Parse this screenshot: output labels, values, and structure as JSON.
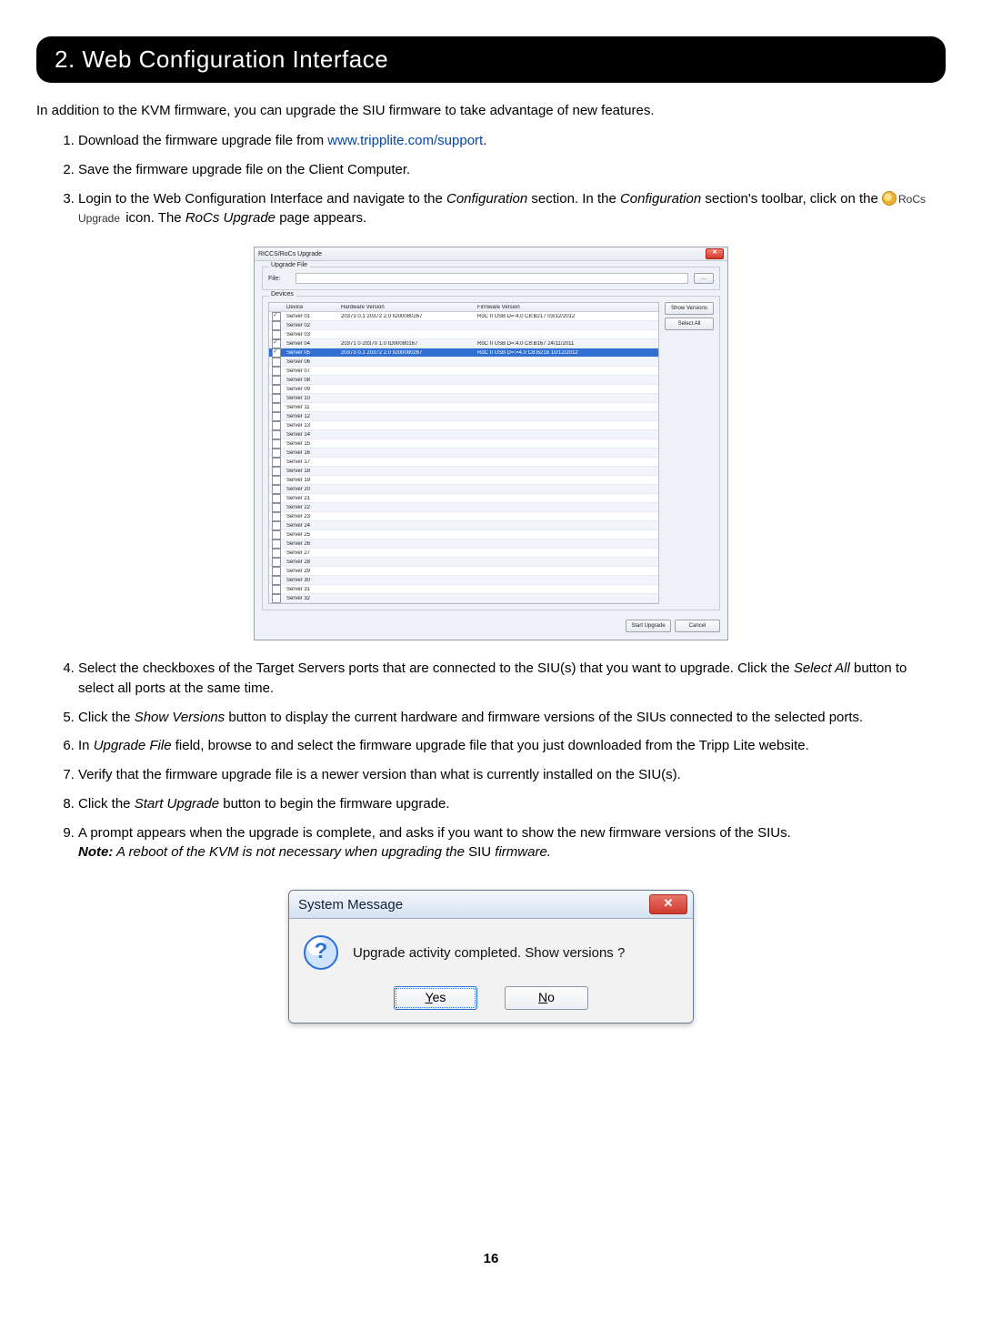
{
  "section_title": "2. Web Configuration Interface",
  "intro": "In addition to the KVM firmware, you can upgrade the SIU firmware to take advantage of new features.",
  "link_text": "www.tripplite.com/support",
  "rocs_label": "RoCs Upgrade",
  "steps": {
    "s1a": "Download the firmware upgrade file from ",
    "s1b": ".",
    "s2": "Save the firmware upgrade file on the Client Computer.",
    "s3a": "Login to the Web Configuration Interface and navigate to the ",
    "s3b": " section. In the ",
    "s3c": " section's toolbar, click on the ",
    "s3d": " icon. The ",
    "s3e": " page appears.",
    "s3_config": "Configuration",
    "s3_rocs": "RoCs Upgrade",
    "s4a": "Select the checkboxes of the Target Servers ports that are connected to the SIU(s) that you want to upgrade. Click the ",
    "s4b": " button to select all ports at the same time.",
    "s4_selectall": "Select All",
    "s5a": "Click the ",
    "s5b": " button to display the current hardware and firmware versions of the SIUs connected to the selected ports.",
    "s5_showver": "Show Versions",
    "s6a": "In ",
    "s6b": " field, browse to and select the firmware upgrade file that you just downloaded from the Tripp Lite website.",
    "s6_upfile": "Upgrade File",
    "s7": "Verify that the firmware upgrade file is a newer version than what is currently installed on the SIU(s).",
    "s8a": "Click the ",
    "s8b": " button to begin the firmware upgrade.",
    "s8_start": "Start Upgrade",
    "s9a": "A prompt appears when the upgrade is complete, and asks if you want to show the new firmware versions of the SIUs.",
    "s9_note_lbl": "Note:",
    "s9_note_a": " A reboot of the KVM is not necessary when upgrading the ",
    "s9_note_b": "SIU",
    "s9_note_c": " firmware."
  },
  "riccs": {
    "title": "RICCS/RoCs Upgrade",
    "upgrade_file_legend": "Upgrade File",
    "file_lbl": "File:",
    "browse": "…",
    "devices_legend": "Devices",
    "cols": {
      "device": "Device",
      "hw": "Hardware Version",
      "fw": "Firmware Version"
    },
    "side": {
      "show": "Show Versions",
      "select": "Select All"
    },
    "footer": {
      "start": "Start Upgrade",
      "cancel": "Cancel"
    },
    "rows": [
      {
        "n": "Server 01",
        "chk": true,
        "hw": "20373 0.1 20372 2.0 ID00080267",
        "fw": "RoC II USB D=:4.0 C8:B217 03/12/2012",
        "sel": false
      },
      {
        "n": "Server 02",
        "chk": false,
        "hw": "",
        "fw": "",
        "sel": false
      },
      {
        "n": "Server 03",
        "chk": false,
        "hw": "",
        "fw": "",
        "sel": false
      },
      {
        "n": "Server 04",
        "chk": true,
        "hw": "20371 0 20370 1.0 ID00080167",
        "fw": "RoC II USB D=:4.0 C8:B167 24/11/2011",
        "sel": false
      },
      {
        "n": "Server 05",
        "chk": true,
        "hw": "20373 0.1 20372 2.0 ID00080267",
        "fw": "RoC II USB D=:=4.0 C8:B218 10/12/2012",
        "sel": true
      },
      {
        "n": "Server 06",
        "chk": false,
        "hw": "",
        "fw": "",
        "sel": false
      },
      {
        "n": "Server 07",
        "chk": false,
        "hw": "",
        "fw": "",
        "sel": false
      },
      {
        "n": "Server 08",
        "chk": false,
        "hw": "",
        "fw": "",
        "sel": false
      },
      {
        "n": "Server 09",
        "chk": false,
        "hw": "",
        "fw": "",
        "sel": false
      },
      {
        "n": "Server 10",
        "chk": false,
        "hw": "",
        "fw": "",
        "sel": false
      },
      {
        "n": "Server 11",
        "chk": false,
        "hw": "",
        "fw": "",
        "sel": false
      },
      {
        "n": "Server 12",
        "chk": false,
        "hw": "",
        "fw": "",
        "sel": false
      },
      {
        "n": "Server 13",
        "chk": false,
        "hw": "",
        "fw": "",
        "sel": false
      },
      {
        "n": "Server 14",
        "chk": false,
        "hw": "",
        "fw": "",
        "sel": false
      },
      {
        "n": "Server 15",
        "chk": false,
        "hw": "",
        "fw": "",
        "sel": false
      },
      {
        "n": "Server 16",
        "chk": false,
        "hw": "",
        "fw": "",
        "sel": false
      },
      {
        "n": "Server 17",
        "chk": false,
        "hw": "",
        "fw": "",
        "sel": false
      },
      {
        "n": "Server 18",
        "chk": false,
        "hw": "",
        "fw": "",
        "sel": false
      },
      {
        "n": "Server 19",
        "chk": false,
        "hw": "",
        "fw": "",
        "sel": false
      },
      {
        "n": "Server 20",
        "chk": false,
        "hw": "",
        "fw": "",
        "sel": false
      },
      {
        "n": "Server 21",
        "chk": false,
        "hw": "",
        "fw": "",
        "sel": false
      },
      {
        "n": "Server 22",
        "chk": false,
        "hw": "",
        "fw": "",
        "sel": false
      },
      {
        "n": "Server 23",
        "chk": false,
        "hw": "",
        "fw": "",
        "sel": false
      },
      {
        "n": "Server 24",
        "chk": false,
        "hw": "",
        "fw": "",
        "sel": false
      },
      {
        "n": "Server 25",
        "chk": false,
        "hw": "",
        "fw": "",
        "sel": false
      },
      {
        "n": "Server 26",
        "chk": false,
        "hw": "",
        "fw": "",
        "sel": false
      },
      {
        "n": "Server 27",
        "chk": false,
        "hw": "",
        "fw": "",
        "sel": false
      },
      {
        "n": "Server 28",
        "chk": false,
        "hw": "",
        "fw": "",
        "sel": false
      },
      {
        "n": "Server 29",
        "chk": false,
        "hw": "",
        "fw": "",
        "sel": false
      },
      {
        "n": "Server 30",
        "chk": false,
        "hw": "",
        "fw": "",
        "sel": false
      },
      {
        "n": "Server 31",
        "chk": false,
        "hw": "",
        "fw": "",
        "sel": false
      },
      {
        "n": "Server 32",
        "chk": false,
        "hw": "",
        "fw": "",
        "sel": false
      }
    ]
  },
  "sysmsg": {
    "title": "System Message",
    "text": "Upgrade activity completed. Show versions ?",
    "yes_u": "Y",
    "yes_rest": "es",
    "no_u": "N",
    "no_rest": "o"
  },
  "page_number": "16"
}
